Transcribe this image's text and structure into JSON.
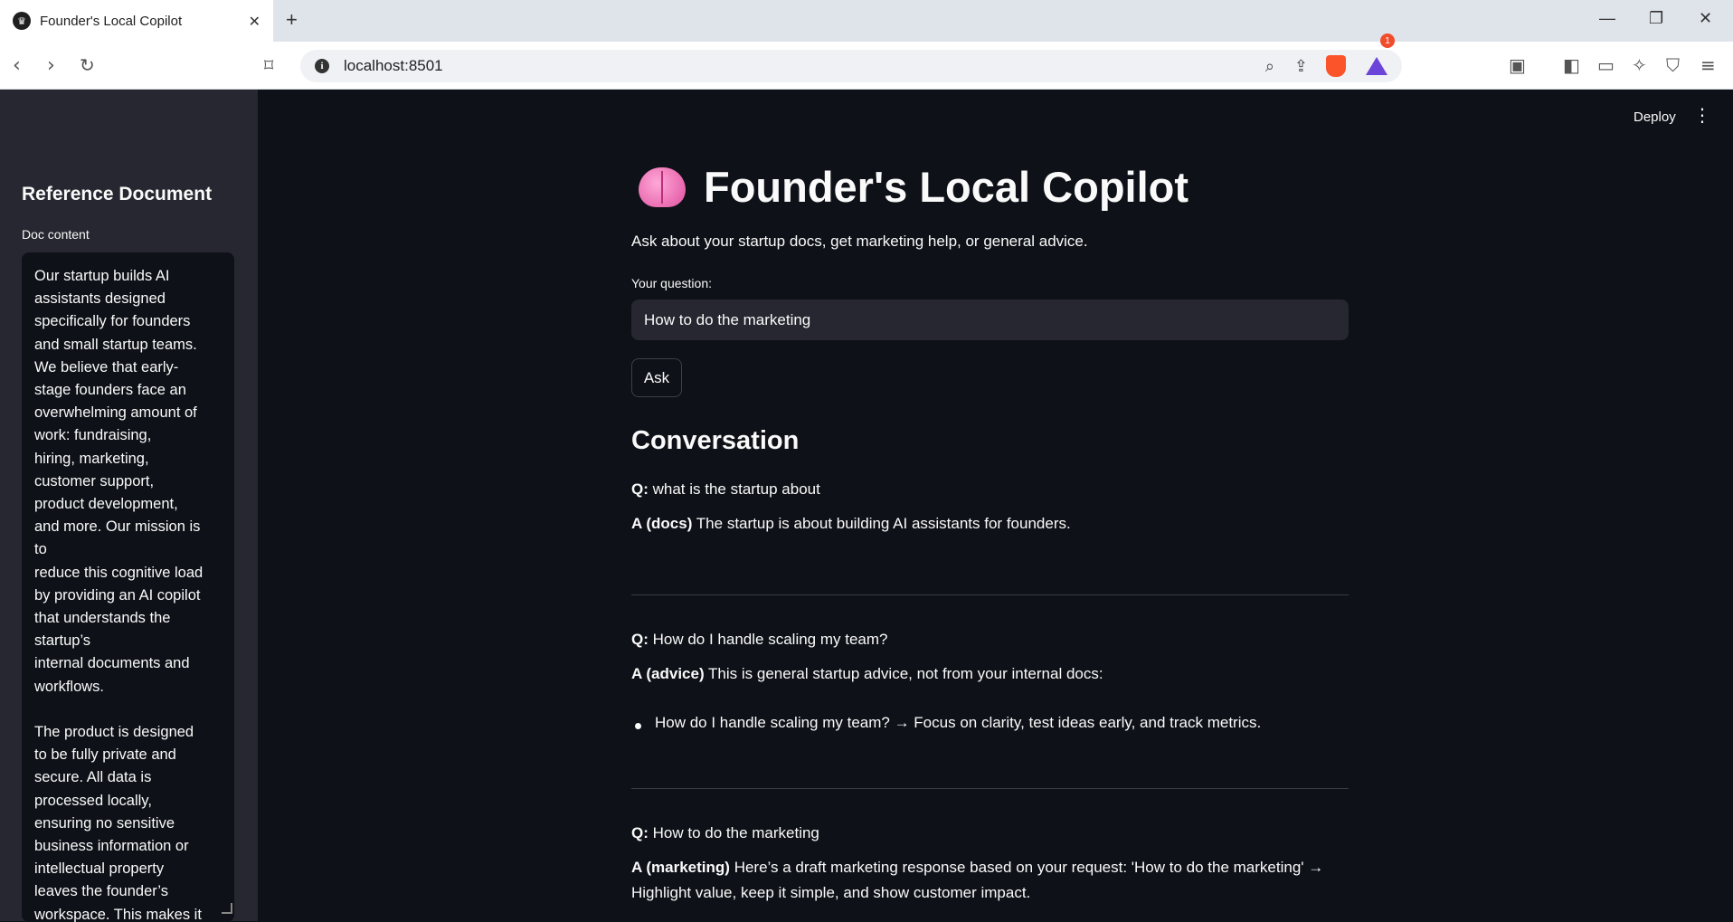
{
  "browser": {
    "tab_title": "Founder's Local Copilot",
    "new_tab": "+",
    "url": "localhost:8501",
    "rewards_badge": "1"
  },
  "app": {
    "deploy_label": "Deploy",
    "sidebar": {
      "title": "Reference Document",
      "doc_label": "Doc content",
      "doc_text": "Our startup builds AI\nassistants designed\nspecifically for founders\nand small startup teams.\nWe believe that early-\nstage founders face an\noverwhelming amount of\nwork: fundraising,\nhiring, marketing,\ncustomer support,\nproduct development,\nand more. Our mission is\nto\nreduce this cognitive load\nby providing an AI copilot\nthat understands the\nstartup’s\ninternal documents and\nworkflows.\n\nThe product is designed\nto be fully private and\nsecure. All data is\nprocessed locally,\nensuring no sensitive\nbusiness information or\nintellectual property\nleaves the founder’s\nworkspace. This makes it"
    },
    "main": {
      "title": "Founder's Local Copilot",
      "subtitle": "Ask about your startup docs, get marketing help, or general advice.",
      "question_label": "Your question:",
      "question_value": "How to do the marketing",
      "ask_label": "Ask",
      "conversation_title": "Conversation",
      "conversation": [
        {
          "q_prefix": "Q:",
          "question": "what is the startup about",
          "a_prefix": "A (docs)",
          "answer": "The startup is about building AI assistants for founders."
        },
        {
          "q_prefix": "Q:",
          "question": "How do I handle scaling my team?",
          "a_prefix": "A (advice)",
          "answer": "This is general startup advice, not from your internal docs:",
          "bullet": "How do I handle scaling my team? → Focus on clarity, test ideas early, and track metrics."
        },
        {
          "q_prefix": "Q:",
          "question": "How to do the marketing",
          "a_prefix": "A (marketing)",
          "answer": "Here’s a draft marketing response based on your request: 'How to do the marketing' →",
          "answer_line2": "Highlight value, keep it simple, and show customer impact."
        }
      ]
    }
  }
}
